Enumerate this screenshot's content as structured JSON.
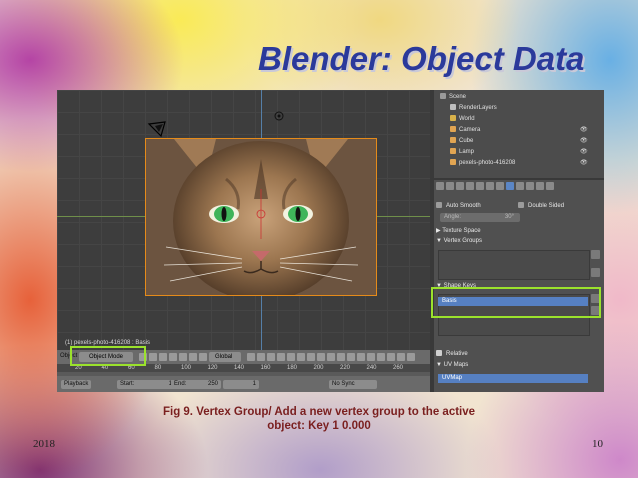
{
  "slide": {
    "title": "Blender: Object Data",
    "caption_line1": "Fig 9. Vertex Group/ Add a new vertex group to the active",
    "caption_line2": "object: Key 1 0.000",
    "year": "2018",
    "page_number": "10",
    "highlight_color": "#9be22c",
    "title_color": "#2b3a9b"
  },
  "viewport": {
    "object_label": "(1) pexels-photo-416208 : Basis",
    "header_label": "Object",
    "mode": "Object Mode",
    "transform_orientation": "Global",
    "timeline_ticks": [
      "20",
      "40",
      "60",
      "80",
      "100",
      "120",
      "140",
      "160",
      "180",
      "200",
      "220",
      "240",
      "260"
    ],
    "playback": {
      "label": "Playback",
      "start_label": "Start:",
      "start_value": "1",
      "end_label": "End:",
      "end_value": "250",
      "current_frame": "1",
      "sync": "No Sync"
    }
  },
  "outliner": {
    "items": [
      {
        "label": "Scene",
        "indent": 0,
        "color": "#9a9a9a"
      },
      {
        "label": "RenderLayers",
        "indent": 1,
        "color": "#bfbfbf"
      },
      {
        "label": "World",
        "indent": 1,
        "color": "#d9b24a"
      },
      {
        "label": "Camera",
        "indent": 1,
        "color": "#e2a552"
      },
      {
        "label": "Cube",
        "indent": 1,
        "color": "#e2a552"
      },
      {
        "label": "Lamp",
        "indent": 1,
        "color": "#e2a552"
      },
      {
        "label": "pexels-photo-416208",
        "indent": 1,
        "color": "#e2a552"
      }
    ]
  },
  "properties": {
    "auto_smooth": "Auto Smooth",
    "double_sided": "Double Sided",
    "angle_label": "Angle:",
    "angle_value": "30°",
    "texture_space": "Texture Space",
    "vertex_groups": "Vertex Groups",
    "shape_keys": "Shape Keys",
    "shape_key_selected": "Basis",
    "relative": "Relative",
    "uv_maps": "UV Maps",
    "uv_map_selected": "UVMap"
  }
}
